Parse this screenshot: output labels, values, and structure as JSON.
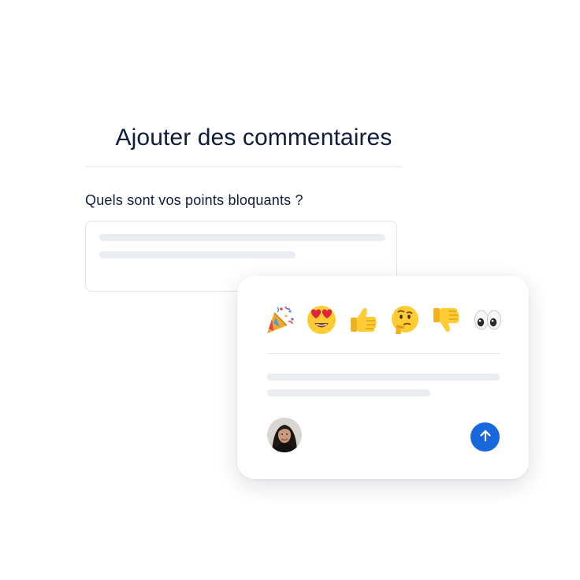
{
  "form": {
    "title": "Ajouter des commentaires",
    "question": "Quels sont vos points bloquants ?"
  },
  "reactions": {
    "emojis": [
      {
        "name": "party-popper-icon",
        "char": "🎉"
      },
      {
        "name": "heart-eyes-icon",
        "char": "😍"
      },
      {
        "name": "thumbs-up-icon",
        "char": "👍"
      },
      {
        "name": "thinking-face-icon",
        "char": "🤔"
      },
      {
        "name": "thumbs-down-icon",
        "char": "👎"
      },
      {
        "name": "eyes-icon",
        "char": "👀"
      }
    ]
  },
  "composer": {
    "send_icon": "arrow-up-icon"
  },
  "colors": {
    "text": "#0e1c3d",
    "accent": "#1868db",
    "skeleton": "#e9edf2",
    "emoji_yellow": "#ffcc33"
  }
}
